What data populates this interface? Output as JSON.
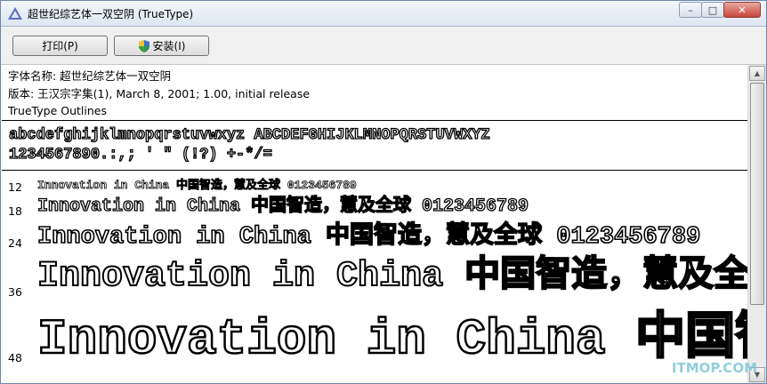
{
  "window": {
    "title": "超世纪综艺体一双空阴 (TrueType)",
    "buttons": {
      "minimize": "–",
      "maximize": "□",
      "close": "✕"
    }
  },
  "toolbar": {
    "print_label": "打印(P)",
    "install_label": "安装(I)"
  },
  "font_info": {
    "name_line": "字体名称: 超世纪综艺体一双空阴",
    "version_line": "版本: 王汉宗字集(1), March 8, 2001; 1.00, initial release",
    "outline_line": "TrueType Outlines"
  },
  "charset": {
    "line1": "abcdefghijklmnopqrstuvwxyz  ABCDEFGHIJKLMNOPQRSTUVWXYZ",
    "line2": "1234567890.:,;  '  \"  (!?)   +-*/="
  },
  "samples": [
    {
      "size": "12",
      "text": "Innovation in China 中国智造，慧及全球 0123456789"
    },
    {
      "size": "18",
      "text": "Innovation in China 中国智造，慧及全球 0123456789"
    },
    {
      "size": "24",
      "text": "Innovation in China 中国智造，慧及全球 0123456789"
    },
    {
      "size": "36",
      "text": "Innovation in China 中国智造，慧及全球"
    },
    {
      "size": "48",
      "text": "Innovation in China 中国智造"
    }
  ],
  "watermark": "ITMOP.COM"
}
